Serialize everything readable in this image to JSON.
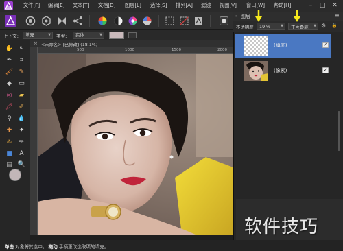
{
  "menu": {
    "items": [
      "文件[F]",
      "编辑[E]",
      "文本[T]",
      "文档[D]",
      "图层[L]",
      "选择[S]",
      "排列[A]",
      "滤镜",
      "视图[V]",
      "窗口[W]",
      "帮助[H]"
    ]
  },
  "context_bar": {
    "context_label": "上下文:",
    "context_value": "填充",
    "type_label": "类型:",
    "type_value": "实体"
  },
  "document": {
    "tab_title": "<未命名> [已修改] (18.1%)",
    "ruler_ticks": [
      "500",
      "1000",
      "1500",
      "2000"
    ]
  },
  "layers": {
    "panel_title": "图层",
    "opacity_label": "不透明度",
    "opacity_value": "19 %",
    "blend_mode": "正片叠底",
    "items": [
      {
        "name": "(填充)",
        "selected": true
      },
      {
        "name": "(像素)",
        "selected": false
      }
    ]
  },
  "status": {
    "click_word": "单击",
    "click_desc": "对象将其选中。",
    "drag_word": "拖动",
    "drag_desc": "手柄更改选取项的填充。"
  },
  "watermark": "软件技巧",
  "colors": {
    "accent": "#9b3fd0",
    "selected_layer": "#4a78c2",
    "annotation_arrow": "#f5e81c"
  }
}
